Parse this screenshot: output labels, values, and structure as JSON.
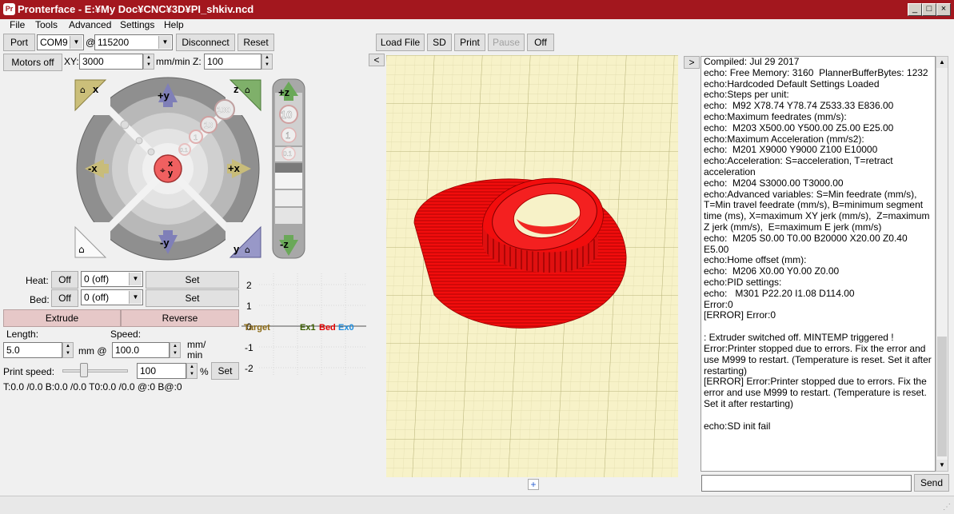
{
  "window": {
    "title": "Pronterface - E:¥My Doc¥CNC¥3D¥PI_shkiv.ncd",
    "app_icon": "pronterface-icon"
  },
  "menu": [
    "File",
    "Tools",
    "Advanced",
    "Settings",
    "Help"
  ],
  "connection": {
    "port_label": "Port",
    "port_value": "COM9",
    "at": "@",
    "baud_value": "115200",
    "disconnect": "Disconnect",
    "reset": "Reset"
  },
  "motors": {
    "motors_off": "Motors off",
    "xy_label": "XY:",
    "xy_value": "3000",
    "mmmin_label": "mm/min",
    "z_label": "Z:",
    "z_value": "100"
  },
  "jog": {
    "home_x": "x",
    "home_z": "z",
    "home_y": "y",
    "plus_y": "+y",
    "minus_y": "-y",
    "plus_x": "+x",
    "minus_x": "-x",
    "step_100": "100",
    "step_10": "10",
    "step_1": "1",
    "step_01": "0.1",
    "center_x": "x",
    "center_y": "y",
    "z_plus": "+z",
    "z_minus": "-z",
    "z_10": "10",
    "z_1": "1",
    "z_01": "0.1"
  },
  "temps": {
    "heat_label": "Heat:",
    "heat_off": "Off",
    "heat_value": "0 (off)",
    "heat_set": "Set",
    "bed_label": "Bed:",
    "bed_off": "Off",
    "bed_value": "0 (off)",
    "bed_set": "Set"
  },
  "extrude": {
    "extrude": "Extrude",
    "reverse": "Reverse",
    "length_label": "Length:",
    "length_value": "5.0",
    "mm_at": "mm @",
    "speed_label": "Speed:",
    "speed_value": "100.0",
    "mmmin": "mm/\nmin"
  },
  "print_speed": {
    "label": "Print speed:",
    "value": "100",
    "pct": "%",
    "set": "Set",
    "slider_fraction": 0.3
  },
  "status_line": "T:0.0 /0.0 B:0.0 /0.0 T0:0.0 /0.0 @:0 B@:0",
  "graph": {
    "yticks": [
      "2",
      "1",
      "0",
      "-1",
      "-2"
    ],
    "legend": [
      {
        "text": "Target",
        "color": "#8b6914"
      },
      {
        "text": "Ex1",
        "color": "#3c5f00"
      },
      {
        "text": "Bed",
        "color": "#e00000"
      },
      {
        "text": "Ex0",
        "color": "#1f8fe0"
      }
    ]
  },
  "toolbar": {
    "load_file": "Load File",
    "sd": "SD",
    "print": "Print",
    "pause": "Pause",
    "off": "Off"
  },
  "panel_toggles": {
    "left": "<",
    "right": ">",
    "plus": "+"
  },
  "console": {
    "lines": [
      "Compiled: Jul 29 2017",
      "echo: Free Memory: 3160  PlannerBufferBytes: 1232",
      "echo:Hardcoded Default Settings Loaded",
      "echo:Steps per unit:",
      "echo:  M92 X78.74 Y78.74 Z533.33 E836.00",
      "echo:Maximum feedrates (mm/s):",
      "echo:  M203 X500.00 Y500.00 Z5.00 E25.00",
      "echo:Maximum Acceleration (mm/s2):",
      "echo:  M201 X9000 Y9000 Z100 E10000",
      "echo:Acceleration: S=acceleration, T=retract acceleration",
      "echo:  M204 S3000.00 T3000.00",
      "echo:Advanced variables: S=Min feedrate (mm/s), T=Min travel feedrate (mm/s), B=minimum segment time (ms), X=maximum XY jerk (mm/s),  Z=maximum Z jerk (mm/s),  E=maximum E jerk (mm/s)",
      "echo:  M205 S0.00 T0.00 B20000 X20.00 Z0.40 E5.00",
      "echo:Home offset (mm):",
      "echo:  M206 X0.00 Y0.00 Z0.00",
      "echo:PID settings:",
      "echo:   M301 P22.20 I1.08 D114.00",
      "Error:0",
      "[ERROR] Error:0",
      "",
      ": Extruder switched off. MINTEMP triggered !",
      "Error:Printer stopped due to errors. Fix the error and use M999 to restart. (Temperature is reset. Set it after restarting)",
      "[ERROR] Error:Printer stopped due to errors. Fix the error and use M999 to restart. (Temperature is reset. Set it after restarting)",
      "",
      "echo:SD init fail"
    ],
    "send": "Send",
    "input_value": ""
  },
  "colors": {
    "title_bar": "#a3171e",
    "model": "#f20d0d",
    "grid_bg": "#f7f2c8",
    "grid_line": "#c9c48a"
  }
}
